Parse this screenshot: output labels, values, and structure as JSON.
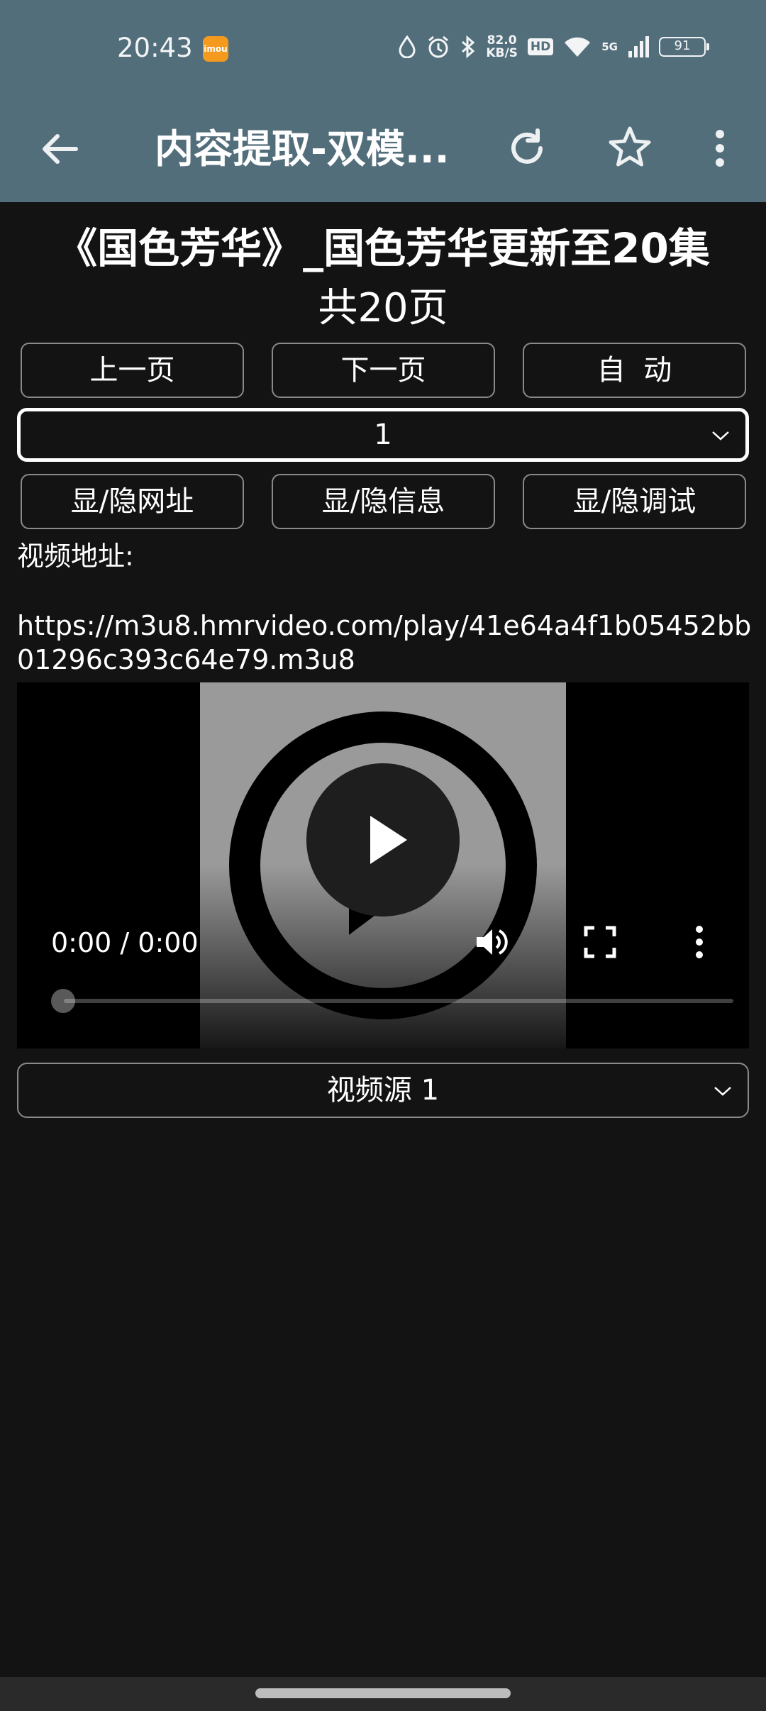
{
  "status_bar": {
    "time": "20:43",
    "app_badge": "imou",
    "net_speed_value": "82.0",
    "net_speed_unit": "KB/S",
    "hd_label": "HD",
    "network_label": "5G",
    "battery": "91"
  },
  "toolbar": {
    "title": "内容提取-双模...",
    "back_icon": "arrow-left",
    "refresh_icon": "refresh",
    "bookmark_icon": "star-outline",
    "menu_icon": "more-vertical"
  },
  "content": {
    "title": "《国色芳华》_国色芳华更新至20集",
    "page_count": "共20页",
    "nav_buttons": [
      "上一页",
      "下一页",
      "自  动"
    ],
    "page_select_value": "1",
    "toggle_buttons": [
      "显/隐网址",
      "显/隐信息",
      "显/隐调试"
    ],
    "address_label": "视频地址:",
    "address_url": "https://m3u8.hmrvideo.com/play/41e64a4f1b05452bb01296c393c64e79.m3u8",
    "source_select_value": "视频源 1"
  },
  "video": {
    "time_display": "0:00 / 0:00",
    "progress": 0
  },
  "colors": {
    "toolbar": "#536e7b",
    "background": "#131313",
    "button_border": "#8a8a8a"
  }
}
